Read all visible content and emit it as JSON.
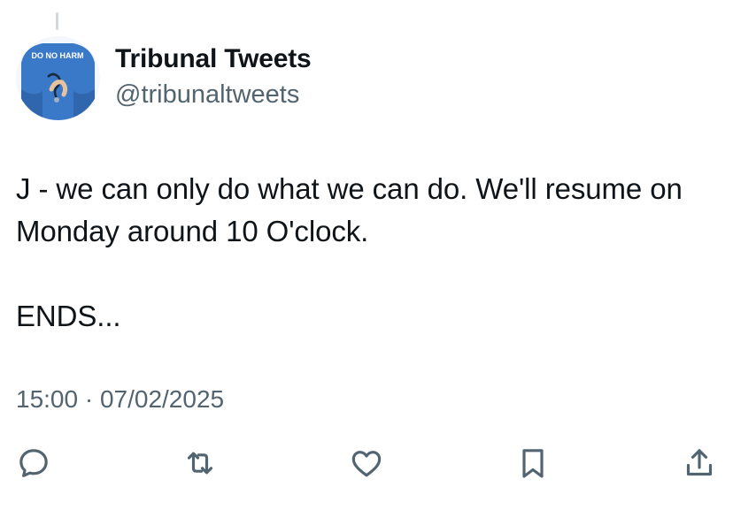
{
  "tweet": {
    "author": {
      "display_name": "Tribunal Tweets",
      "handle": "@tribunaltweets",
      "avatar_text": "DO NO HARM"
    },
    "text": "J - we can only do what we can do. We'll resume on Monday around 10 O'clock.\n\nENDS...",
    "timestamp": "15:00 · 07/02/2025"
  },
  "actions": [
    {
      "name": "reply",
      "icon": "reply-icon"
    },
    {
      "name": "retweet",
      "icon": "retweet-icon"
    },
    {
      "name": "like",
      "icon": "heart-icon"
    },
    {
      "name": "bookmark",
      "icon": "bookmark-icon"
    },
    {
      "name": "share",
      "icon": "share-icon"
    }
  ],
  "colors": {
    "text": "#0f1419",
    "secondary": "#536471",
    "icon": "#536471",
    "avatar_blue": "#3a78c8"
  }
}
